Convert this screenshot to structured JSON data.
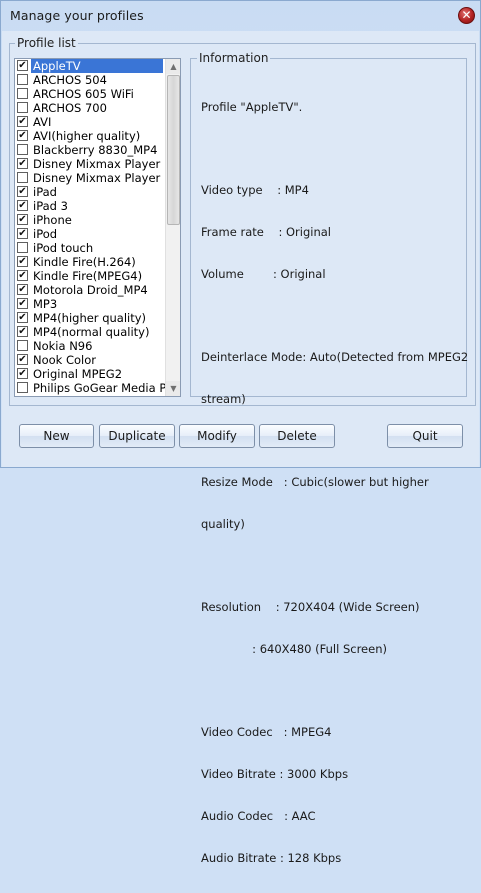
{
  "window": {
    "title": "Manage your profiles",
    "close_glyph": "✕"
  },
  "profile_list": {
    "group_label": "Profile list",
    "items": [
      {
        "label": "AppleTV",
        "checked": true,
        "selected": true
      },
      {
        "label": "ARCHOS 504",
        "checked": false
      },
      {
        "label": "ARCHOS 605 WiFi",
        "checked": false
      },
      {
        "label": "ARCHOS 700",
        "checked": false
      },
      {
        "label": "AVI",
        "checked": true
      },
      {
        "label": "AVI(higher quality)",
        "checked": true
      },
      {
        "label": "Blackberry 8830_MP4",
        "checked": false
      },
      {
        "label": "Disney Mixmax Player",
        "checked": true
      },
      {
        "label": "Disney Mixmax Player Plu",
        "checked": false
      },
      {
        "label": "iPad",
        "checked": true
      },
      {
        "label": "iPad 3",
        "checked": true
      },
      {
        "label": "iPhone",
        "checked": true
      },
      {
        "label": "iPod",
        "checked": true
      },
      {
        "label": "iPod touch",
        "checked": false
      },
      {
        "label": "Kindle Fire(H.264)",
        "checked": true
      },
      {
        "label": "Kindle Fire(MPEG4)",
        "checked": true
      },
      {
        "label": "Motorola Droid_MP4",
        "checked": true
      },
      {
        "label": "MP3",
        "checked": true
      },
      {
        "label": "MP4(higher quality)",
        "checked": true
      },
      {
        "label": "MP4(normal quality)",
        "checked": true
      },
      {
        "label": "Nokia N96",
        "checked": false
      },
      {
        "label": "Nook Color",
        "checked": true
      },
      {
        "label": "Original MPEG2",
        "checked": true
      },
      {
        "label": "Philips GoGear Media Pla",
        "checked": false
      }
    ],
    "check_glyph": "✔",
    "scroll_up_glyph": "▲",
    "scroll_down_glyph": "▼"
  },
  "information": {
    "group_label": "Information",
    "profile_line": "Profile \"AppleTV\".",
    "video_type": "Video type    : MP4",
    "frame_rate": "Frame rate    : Original",
    "volume": "Volume        : Original",
    "deinterlace_1": "Deinterlace Mode: Auto(Detected from MPEG2",
    "deinterlace_2": "stream)",
    "resize_1": "Resize Mode   : Cubic(slower but higher",
    "resize_2": "quality)",
    "resolution_1": "Resolution    : 720X404 (Wide Screen)",
    "resolution_2": "              : 640X480 (Full Screen)",
    "video_codec": "Video Codec   : MPEG4",
    "video_bitrate": "Video Bitrate : 3000 Kbps",
    "audio_codec": "Audio Codec   : AAC",
    "audio_bitrate": "Audio Bitrate : 128 Kbps"
  },
  "buttons": {
    "new": "New",
    "duplicate": "Duplicate",
    "modify": "Modify",
    "delete": "Delete",
    "quit": "Quit"
  }
}
